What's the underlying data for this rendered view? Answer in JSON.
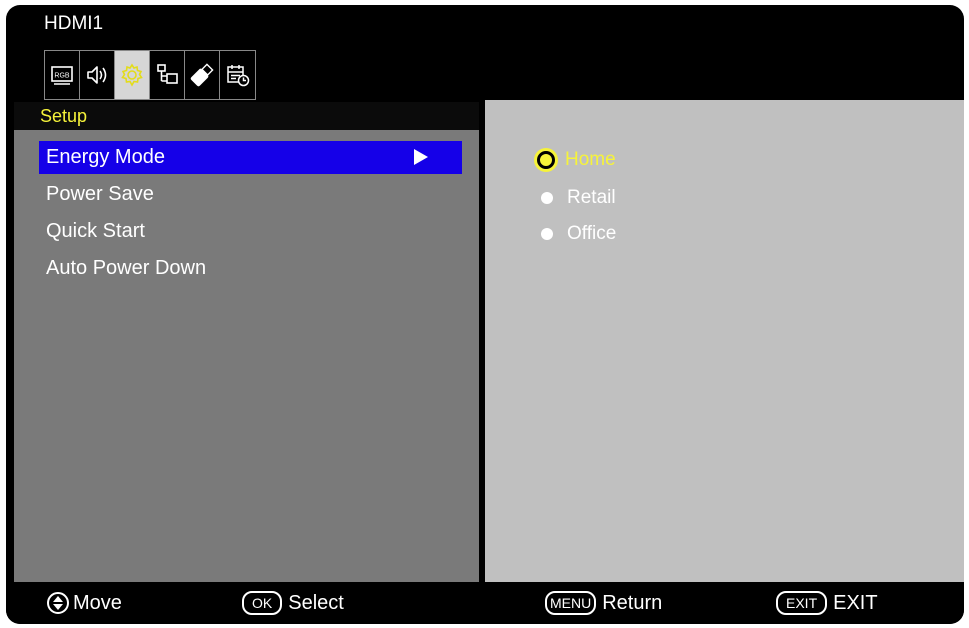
{
  "source": "HDMI1",
  "tabs": [
    {
      "icon": "rgb-picture-icon",
      "active": false
    },
    {
      "icon": "speaker-audio-icon",
      "active": false
    },
    {
      "icon": "gear-setup-icon",
      "active": true
    },
    {
      "icon": "network-icon",
      "active": false
    },
    {
      "icon": "usb-stick-icon",
      "active": false
    },
    {
      "icon": "schedule-calendar-icon",
      "active": false
    }
  ],
  "rgb_label": "RGB",
  "section_title": "Setup",
  "menu": {
    "items": [
      {
        "label": "Energy Mode",
        "selected": true
      },
      {
        "label": "Power Save",
        "selected": false
      },
      {
        "label": "Quick Start",
        "selected": false
      },
      {
        "label": "Auto Power Down",
        "selected": false
      }
    ]
  },
  "options": {
    "items": [
      {
        "label": "Home",
        "selected": true
      },
      {
        "label": "Retail",
        "selected": false
      },
      {
        "label": "Office",
        "selected": false
      }
    ]
  },
  "footer": {
    "move": "Move",
    "ok_key": "OK",
    "select": "Select",
    "menu_key": "MENU",
    "return": "Return",
    "exit_key": "EXIT",
    "exit": "EXIT"
  },
  "colors": {
    "highlight_text": "#f6f33a",
    "selection_bar": "#1500e8",
    "menu_panel": "#7a7a7a",
    "submenu_panel": "#c0c0c0"
  }
}
